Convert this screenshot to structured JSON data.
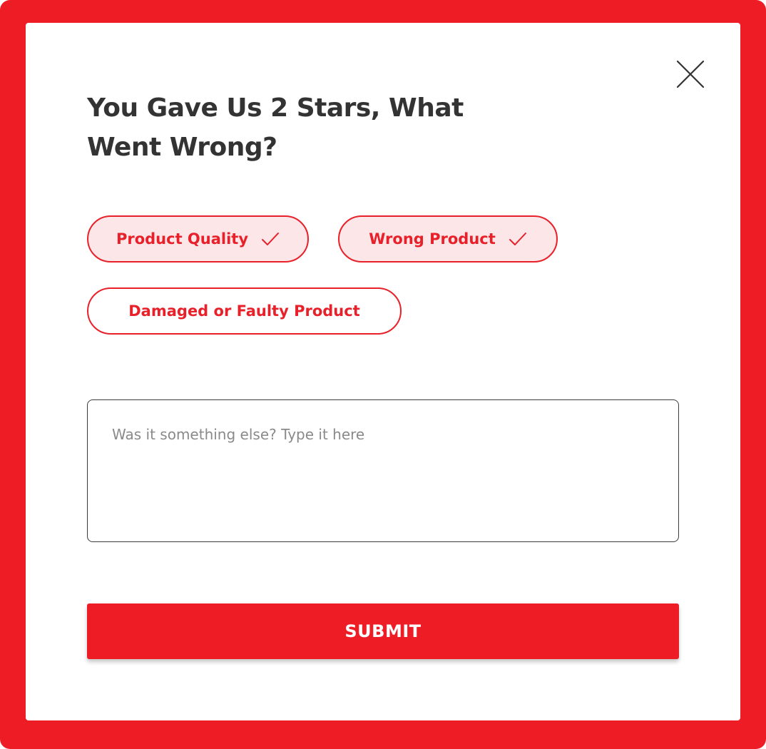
{
  "colors": {
    "accent": "#ee1c25",
    "chip_selected_bg": "#fde6e7",
    "title_text": "#333333",
    "placeholder_text": "#8a8a8a"
  },
  "modal": {
    "title": "You Gave Us 2 Stars, What Went Wrong?",
    "close_icon": "close-icon"
  },
  "options": [
    {
      "label": "Product Quality",
      "selected": true,
      "icon": "checkmark-icon"
    },
    {
      "label": "Wrong Product",
      "selected": true,
      "icon": "checkmark-icon"
    },
    {
      "label": "Damaged or Faulty Product",
      "selected": false
    }
  ],
  "feedback": {
    "placeholder": "Was it something else? Type it here",
    "value": ""
  },
  "submit": {
    "label": "SUBMIT"
  }
}
